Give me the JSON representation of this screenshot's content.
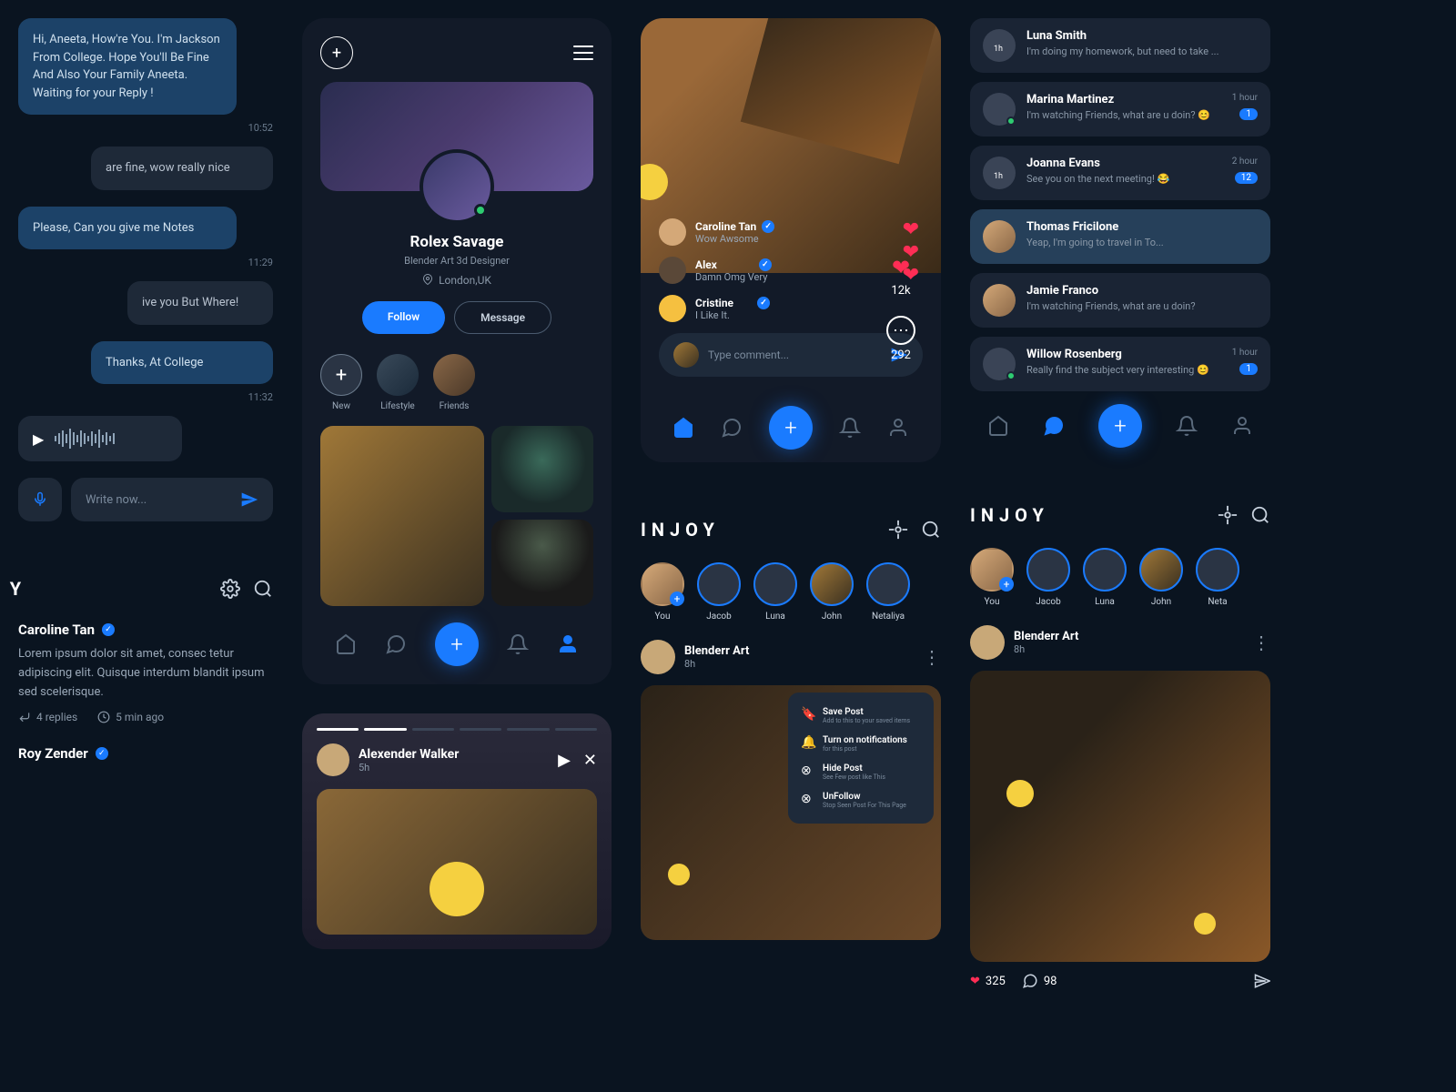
{
  "brand": "INJOY",
  "chat": {
    "m1": "Hi, Aneeta, How're You. I'm Jackson From College. Hope You'll Be Fine And Also Your Family Aneeta. Waiting for your Reply !",
    "t1": "10:52",
    "m2": "are fine, wow really nice",
    "m3": "Please, Can you give me Notes",
    "t3": "11:29",
    "m4": "ive you But Where!",
    "m5": "Thanks, At College",
    "t5": "11:32",
    "write": "Write now..."
  },
  "feed": {
    "c1_name": "Caroline Tan",
    "c1_text": "Lorem ipsum dolor sit amet, consec tetur adipiscing elit. Quisque interdum blandit ipsum sed scelerisque.",
    "c1_replies": "4 replies",
    "c1_time": "5 min ago",
    "c2_name": "Roy Zender"
  },
  "profile": {
    "name": "Rolex Savage",
    "sub": "Blender Art 3d Designer",
    "loc": "London,UK",
    "follow": "Follow",
    "message": "Message",
    "new": "New",
    "lifestyle": "Lifestyle",
    "friends": "Friends"
  },
  "story": {
    "name": "Alexender Walker",
    "time": "5h"
  },
  "post": {
    "likes": "12k",
    "comments": "292",
    "c1_name": "Caroline Tan",
    "c1_msg": "Wow Awsome",
    "c2_name": "Alex",
    "c2_msg": "Damn Omg Very",
    "c3_name": "Cristine",
    "c3_msg": "I Like It.",
    "type": "Type comment..."
  },
  "home": {
    "stories": {
      "you": "You",
      "jacob": "Jacob",
      "luna": "Luna",
      "john": "John",
      "neta": "Netaliya",
      "neta2": "Neta"
    },
    "post_name": "Blenderr Art",
    "post_time": "8h",
    "menu": {
      "save": "Save Post",
      "save_s": "Add to this to your saved items",
      "notif": "Turn on notifications",
      "notif_s": "for this post",
      "hide": "Hide Post",
      "hide_s": "See Few post like This",
      "unf": "UnFollow",
      "unf_s": "Stop Seen Post For This Page"
    },
    "likes": "325",
    "comm": "98"
  },
  "msgs": {
    "m0_name": "Luna Smith",
    "m0_prev": "I'm doing my homework, but need to take ...",
    "m1_name": "Marina Martinez",
    "m1_prev": "I'm watching Friends, what are u doin? 😊",
    "m1_t": "1 hour",
    "m1_b": "1",
    "m2_name": "Joanna Evans",
    "m2_prev": "See you on the next meeting! 😂",
    "m2_t": "2 hour",
    "m2_b": "12",
    "m3_name": "Thomas Fricilone",
    "m3_prev": "Yeap, I'm going to travel in To...",
    "m4_name": "Jamie Franco",
    "m4_prev": "I'm watching Friends, what are u doin?",
    "m5_name": "Willow Rosenberg",
    "m5_prev": "Really find the subject very interesting 😊",
    "m5_t": "1 hour",
    "m5_b": "1"
  }
}
